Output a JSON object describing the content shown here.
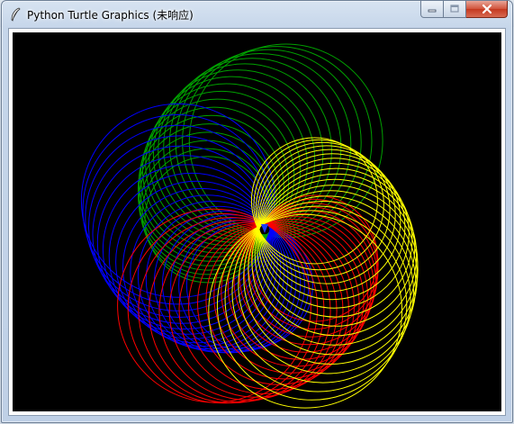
{
  "window": {
    "title": "Python Turtle Graphics (未响应)"
  },
  "controls": {
    "minimize_icon": "minimize-icon",
    "maximize_icon": "maximize-icon",
    "close_icon": "close-icon"
  },
  "canvas": {
    "background": "#000000",
    "petals": [
      {
        "color": "#00a000"
      },
      {
        "color": "#0000ff"
      },
      {
        "color": "#ff0000"
      },
      {
        "color": "#ffff00"
      }
    ]
  }
}
